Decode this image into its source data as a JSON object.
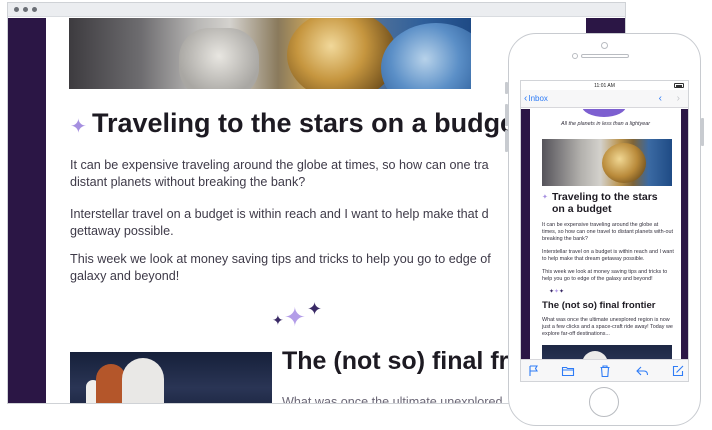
{
  "desktop": {
    "article": {
      "title": "Traveling to the stars on a budget",
      "paragraphs": [
        "It can be expensive traveling around the globe at times, so how can one tra distant planets without breaking the bank?",
        "Interstellar travel on a budget is within reach and I want to help make that d gettaway possible.",
        "This week we look at money saving tips and tricks to help you go to edge of galaxy and beyond!"
      ],
      "section_title": "The (not so) final fro",
      "section_text": "What was once the ultimate unexplored"
    }
  },
  "phone": {
    "status_time": "11:01 AM",
    "nav": {
      "back_label": "Inbox"
    },
    "email": {
      "tagline": "All the planets in less than a lightyear",
      "title": "Traveling to the stars on a budget",
      "paragraphs": [
        "It can be expensive traveling around the globe at times, so how can one travel to distant planets with-out breaking the bank?",
        "Interstellar travel on a budget is within reach and I want to help make that dream getaway possible.",
        "This week we look at money saving tips and tricks to help you go to edge of the galaxy and beyond!"
      ],
      "section_title": "The (not so) final frontier",
      "section_text": "What was once the ultimate unexplored region is now just a few clicks and a space-craft ride away! Today we explore far-off destinations..."
    },
    "toolbar": [
      "flag-icon",
      "folder-icon",
      "trash-icon",
      "reply-icon",
      "compose-icon"
    ]
  },
  "colors": {
    "brand_purple": "#2b1645",
    "sparkle_light": "#b39de8",
    "ios_blue": "#2f7cf6"
  }
}
